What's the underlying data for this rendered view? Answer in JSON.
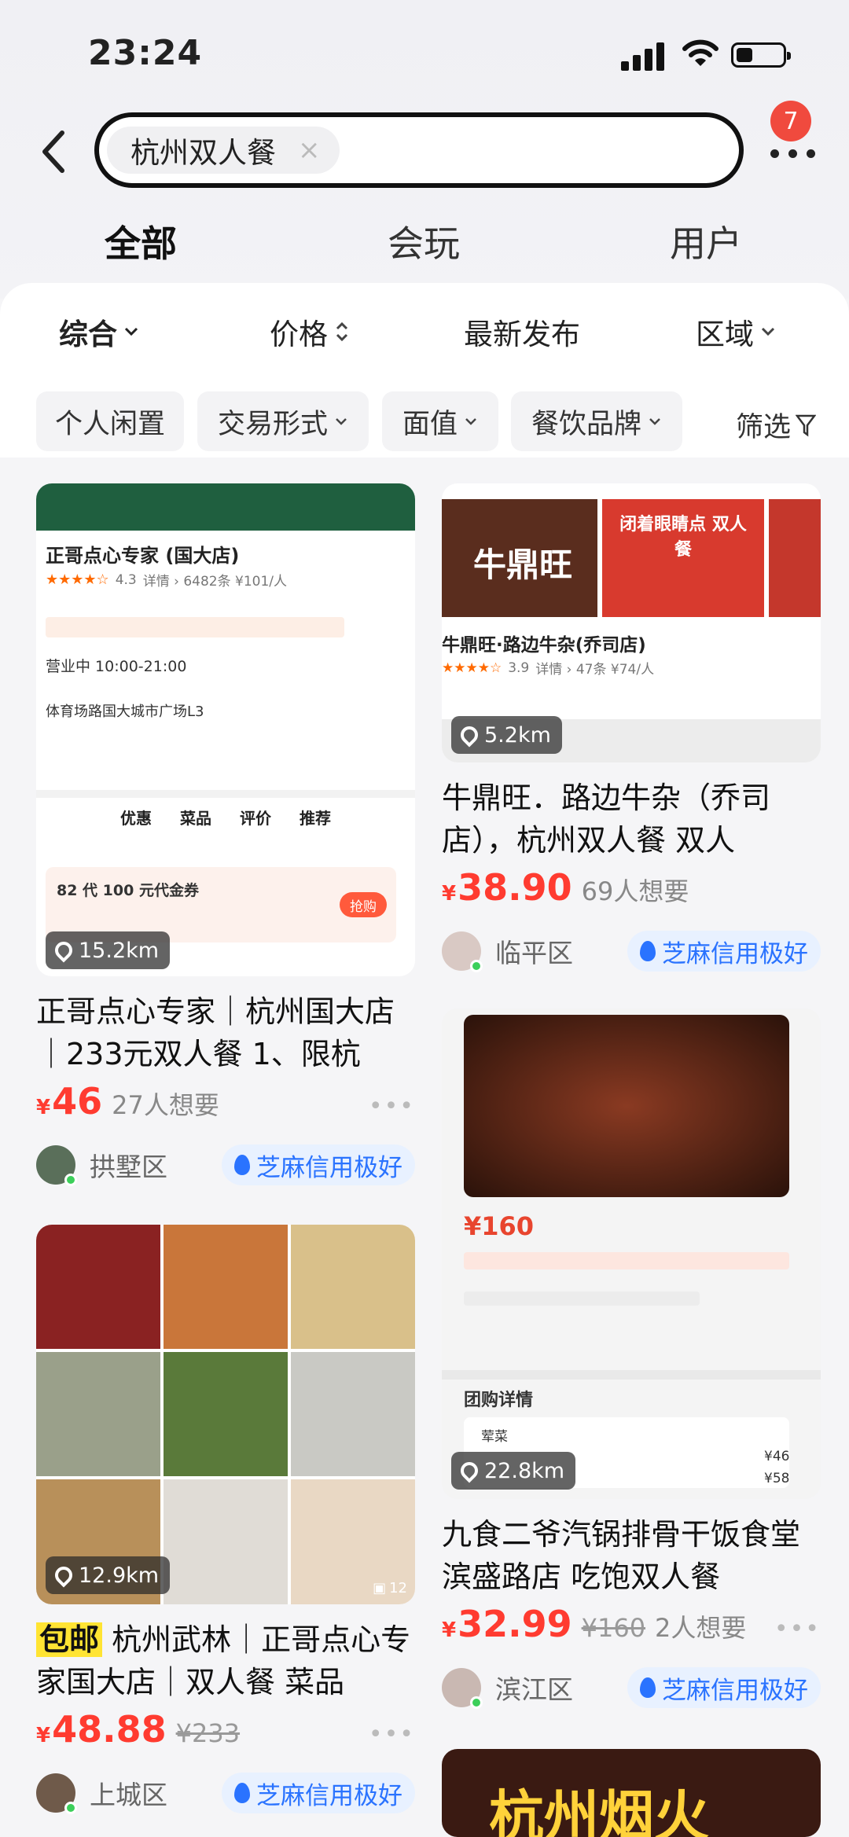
{
  "status": {
    "time": "23:24"
  },
  "search": {
    "query": "杭州双人餐",
    "clear_icon": "×",
    "badge_count": "7"
  },
  "main_tabs": [
    {
      "label": "全部",
      "active": true
    },
    {
      "label": "会玩",
      "active": false
    },
    {
      "label": "用户",
      "active": false
    }
  ],
  "sort": [
    {
      "label": "综合",
      "icon": "chevron-down"
    },
    {
      "label": "价格",
      "icon": "sort-updown"
    },
    {
      "label": "最新发布",
      "icon": ""
    },
    {
      "label": "区域",
      "icon": "chevron-down"
    }
  ],
  "filters": [
    {
      "label": "个人闲置"
    },
    {
      "label": "交易形式"
    },
    {
      "label": "面值"
    },
    {
      "label": "餐饮品牌"
    }
  ],
  "filter_more": "筛选",
  "cards": [
    {
      "distance": "15.2km",
      "title": "正哥点心专家｜杭州国大店｜233元双人餐 1、限杭",
      "currency": "¥",
      "price": "46",
      "orig_price": "",
      "want": "27人想要",
      "area": "拱墅区",
      "credit": "芝麻信用极好",
      "image": {
        "shop_name": "正哥点心专家 (国大店)",
        "rating": "4.3",
        "sub": "详情 › 6482条 ¥101/人",
        "hours": "营业中 10:00-21:00",
        "address": "体育场路国大城市广场L3",
        "tabs": [
          "优惠",
          "菜品",
          "评价",
          "推荐"
        ],
        "voucher": "82 代 100 元代金券",
        "voucher_btn": "抢购"
      }
    },
    {
      "distance": "5.2km",
      "title": "牛鼎旺．路边牛杂（乔司店），杭州双人餐 双人",
      "currency": "¥",
      "price": "38.90",
      "orig_price": "",
      "want": "69人想要",
      "area": "临平区",
      "credit": "芝麻信用极好",
      "image": {
        "shop_name": "牛鼎旺·路边牛杂(乔司店)",
        "rating": "3.9",
        "sub": "详情 › 47条 ¥74/人",
        "promo": "闭着眼睛点 双人餐",
        "logo": "牛鼎旺"
      }
    },
    {
      "distance": "22.8km",
      "title": "九食二爷汽锅排骨干饭食堂 滨盛路店 吃饱双人餐",
      "currency": "¥",
      "price": "32.99",
      "orig_price": "¥160",
      "want": "2人想要",
      "area": "滨江区",
      "credit": "芝麻信用极好",
      "image": {
        "price": "¥160",
        "section": "团购详情",
        "item": "荤菜",
        "line1": "¥46",
        "line2": "¥58"
      }
    },
    {
      "distance": "12.9km",
      "tag": "包邮",
      "title": " 杭州武林｜正哥点心专家国大店｜双人餐 菜品",
      "currency": "¥",
      "price": "48.88",
      "orig_price": "¥233",
      "want": "",
      "area": "上城区",
      "credit": "芝麻信用极好",
      "image": {
        "count": "12"
      }
    },
    {
      "image": {
        "text": "杭州烟火"
      }
    }
  ]
}
